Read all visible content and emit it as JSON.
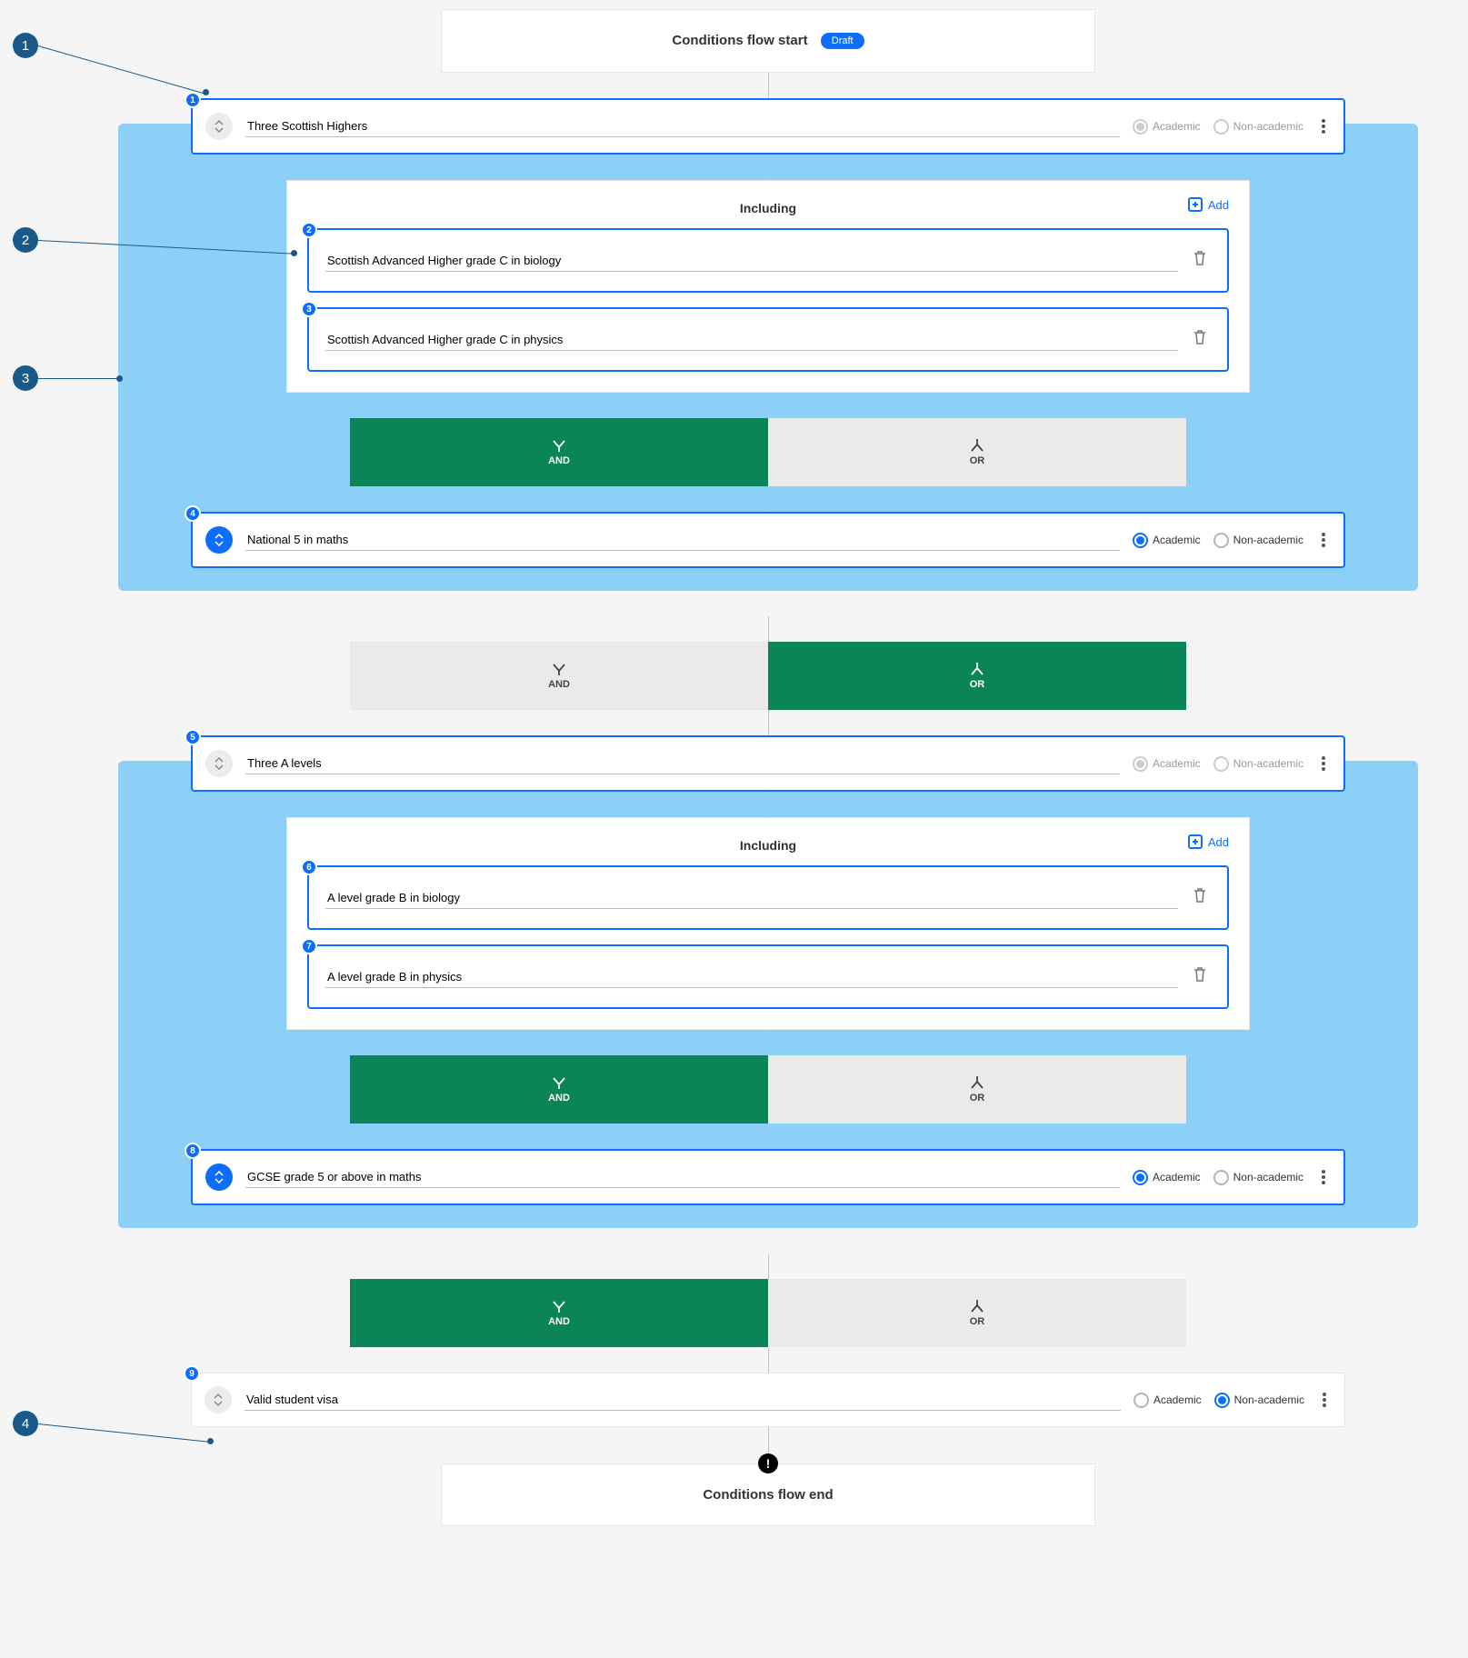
{
  "header": {
    "title": "Conditions flow start",
    "pill": "Draft"
  },
  "footer": {
    "title": "Conditions flow end"
  },
  "labels": {
    "including": "Including",
    "add": "Add",
    "and": "AND",
    "or": "OR",
    "academic": "Academic",
    "nonacademic": "Non-academic"
  },
  "annotations": [
    "1",
    "2",
    "3",
    "4"
  ],
  "group1": {
    "cond1": {
      "num": "1",
      "text": "Three Scottish Highers",
      "academic": true,
      "nonacademic": false,
      "disabled": true
    },
    "includes": [
      {
        "num": "2",
        "text": "Scottish Advanced Higher grade C in biology"
      },
      {
        "num": "3",
        "text": "Scottish Advanced Higher grade C in physics"
      }
    ],
    "innerOp": "AND",
    "cond2": {
      "num": "4",
      "text": "National 5 in maths",
      "academic": true,
      "nonacademic": false,
      "disabled": false
    }
  },
  "midOp": "OR",
  "group2": {
    "cond1": {
      "num": "5",
      "text": "Three A levels",
      "academic": true,
      "nonacademic": false,
      "disabled": true
    },
    "includes": [
      {
        "num": "6",
        "text": "A level grade B in biology"
      },
      {
        "num": "7",
        "text": "A level grade B in physics"
      }
    ],
    "innerOp": "AND",
    "cond2": {
      "num": "8",
      "text": "GCSE grade 5 or above in maths",
      "academic": true,
      "nonacademic": false,
      "disabled": false
    }
  },
  "tailOp": "AND",
  "final": {
    "num": "9",
    "text": "Valid student visa",
    "academic": false,
    "nonacademic": true,
    "disabled": false
  }
}
